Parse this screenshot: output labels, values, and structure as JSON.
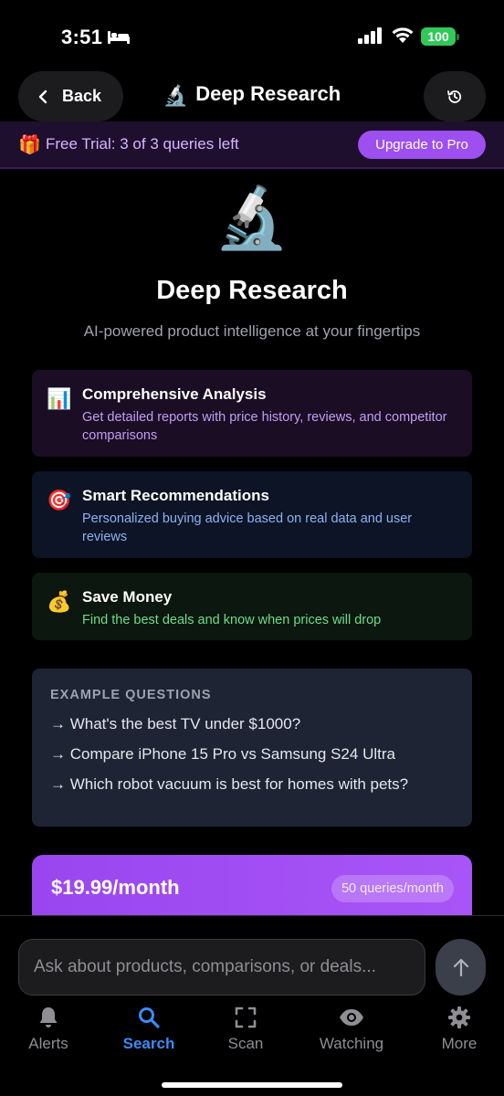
{
  "status_bar": {
    "time": "3:51",
    "battery": "100"
  },
  "header": {
    "back_label": "Back",
    "title_icon": "🔬",
    "title": "Deep Research"
  },
  "trial_banner": {
    "icon": "🎁",
    "text": "Free Trial: 3 of 3 queries left",
    "upgrade_label": "Upgrade to Pro"
  },
  "hero": {
    "icon": "🔬",
    "title": "Deep Research",
    "subtitle": "AI-powered product intelligence at your fingertips"
  },
  "features": [
    {
      "icon": "📊",
      "title": "Comprehensive Analysis",
      "description": "Get detailed reports with price history, reviews, and competitor comparisons"
    },
    {
      "icon": "🎯",
      "title": "Smart Recommendations",
      "description": "Personalized buying advice based on real data and user reviews"
    },
    {
      "icon": "💰",
      "title": "Save Money",
      "description": "Find the best deals and know when prices will drop"
    }
  ],
  "examples": {
    "heading": "EXAMPLE QUESTIONS",
    "items": [
      "→ What's the best TV under $1000?",
      "→ Compare iPhone 15 Pro vs Samsung S24 Ultra",
      "→ Which robot vacuum is best for homes with pets?"
    ]
  },
  "pricing": {
    "price": "$19.99/month",
    "queries": "50 queries/month"
  },
  "composer": {
    "placeholder": "Ask about products, comparisons, or deals..."
  },
  "tabs": [
    {
      "label": "Alerts",
      "icon": "bell-icon",
      "active": false
    },
    {
      "label": "Search",
      "icon": "search-icon",
      "active": true
    },
    {
      "label": "Scan",
      "icon": "scan-icon",
      "active": false
    },
    {
      "label": "Watching",
      "icon": "eye-icon",
      "active": false
    },
    {
      "label": "More",
      "icon": "gear-icon",
      "active": false
    }
  ],
  "colors": {
    "accent": "#9d4ff0",
    "tab_active": "#3b8bf5",
    "battery": "#32c85a"
  }
}
